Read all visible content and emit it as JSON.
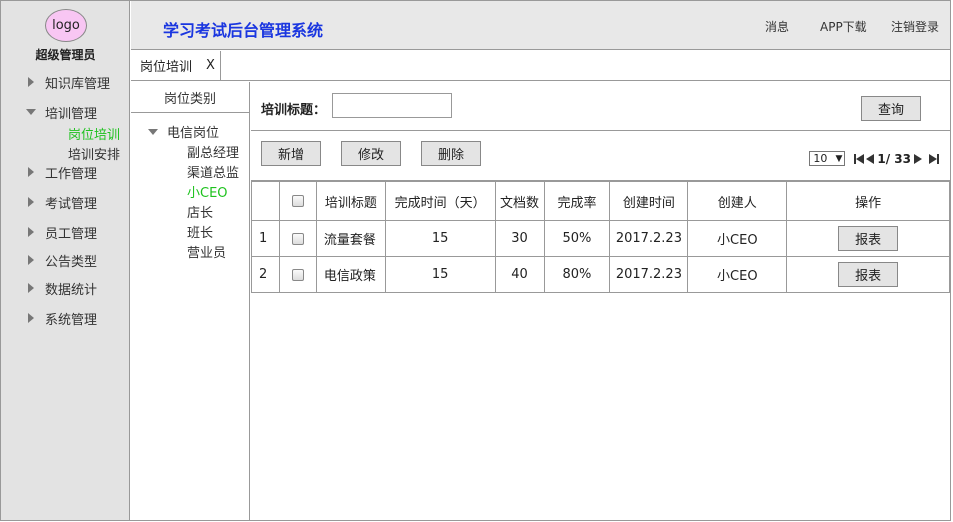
{
  "sidebar": {
    "logo_text": "logo",
    "user_role": "超级管理员",
    "items": [
      {
        "label": "知识库管理",
        "expanded": false
      },
      {
        "label": "培训管理",
        "expanded": true,
        "children": [
          "岗位培训",
          "培训安排"
        ],
        "active_child": "岗位培训"
      },
      {
        "label": "工作管理",
        "expanded": false
      },
      {
        "label": "考试管理",
        "expanded": false
      },
      {
        "label": "员工管理",
        "expanded": false
      },
      {
        "label": "公告类型",
        "expanded": false
      },
      {
        "label": "数据统计",
        "expanded": false
      },
      {
        "label": "系统管理",
        "expanded": false
      }
    ]
  },
  "header": {
    "title": "学习考试后台管理系统",
    "links": [
      "消息",
      "APP下载",
      "注销登录"
    ]
  },
  "tabs": [
    {
      "label": "岗位培训",
      "close": "X"
    }
  ],
  "category_tree": {
    "header": "岗位类别",
    "root": "电信岗位",
    "children": [
      "副总经理",
      "渠道总监",
      "小CEO",
      "店长",
      "班长",
      "营业员"
    ],
    "active": "小CEO"
  },
  "search": {
    "label": "培训标题：",
    "value": "",
    "button": "查询"
  },
  "actions": {
    "add": "新增",
    "edit": "修改",
    "delete": "删除"
  },
  "pager": {
    "page_size": "10",
    "page_info": "1/ 33"
  },
  "table": {
    "columns": [
      "",
      "",
      "培训标题",
      "完成时间（天）",
      "文档数",
      "完成率",
      "创建时间",
      "创建人",
      "操作"
    ],
    "rows": [
      {
        "index": "1",
        "title": "流量套餐",
        "days": "15",
        "docs": "30",
        "rate": "50%",
        "created": "2017.2.23",
        "creator": "小CEO",
        "action": "报表"
      },
      {
        "index": "2",
        "title": "电信政策",
        "days": "15",
        "docs": "40",
        "rate": "80%",
        "created": "2017.2.23",
        "creator": "小CEO",
        "action": "报表"
      }
    ]
  },
  "colors": {
    "title_blue": "#1a36e0",
    "active_green": "#1ec21e",
    "sidebar_bg": "#e3e3e3",
    "logo_pink": "#f8c6f3"
  }
}
